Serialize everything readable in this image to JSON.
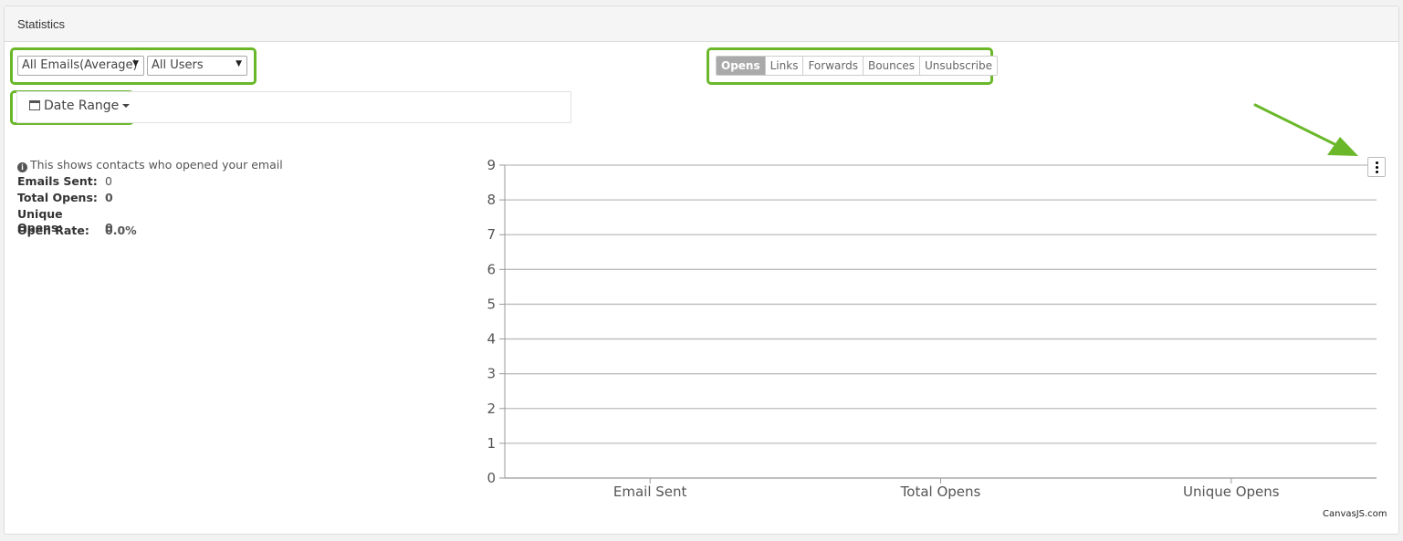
{
  "panel": {
    "title": "Statistics"
  },
  "filters": {
    "email_select": "All Emails(Average)",
    "user_select": "All Users",
    "date_range_label": "Date Range"
  },
  "tabs": [
    {
      "label": "Opens",
      "active": true
    },
    {
      "label": "Links",
      "active": false
    },
    {
      "label": "Forwards",
      "active": false
    },
    {
      "label": "Bounces",
      "active": false
    },
    {
      "label": "Unsubscribe",
      "active": false
    }
  ],
  "info": {
    "text": "This shows contacts who opened your email",
    "stats": [
      {
        "label": "Emails Sent:",
        "value": "0"
      },
      {
        "label": "Total Opens:",
        "value": "0"
      },
      {
        "label": "Unique Opens:",
        "value": "0"
      },
      {
        "label": "Open Rate:",
        "value": "0.0%"
      }
    ]
  },
  "chart_credit": "CanvasJS.com",
  "colors": {
    "highlight": "#6ab82a",
    "active_tab": "#aaaaaa",
    "grid": "#bbbbbb"
  },
  "chart_data": {
    "type": "bar",
    "categories": [
      "Email Sent",
      "Total Opens",
      "Unique Opens"
    ],
    "values": [
      0,
      0,
      0
    ],
    "title": "",
    "xlabel": "",
    "ylabel": "",
    "ylim": [
      0,
      9
    ],
    "yticks": [
      0,
      1,
      2,
      3,
      4,
      5,
      6,
      7,
      8,
      9
    ],
    "grid": true
  }
}
